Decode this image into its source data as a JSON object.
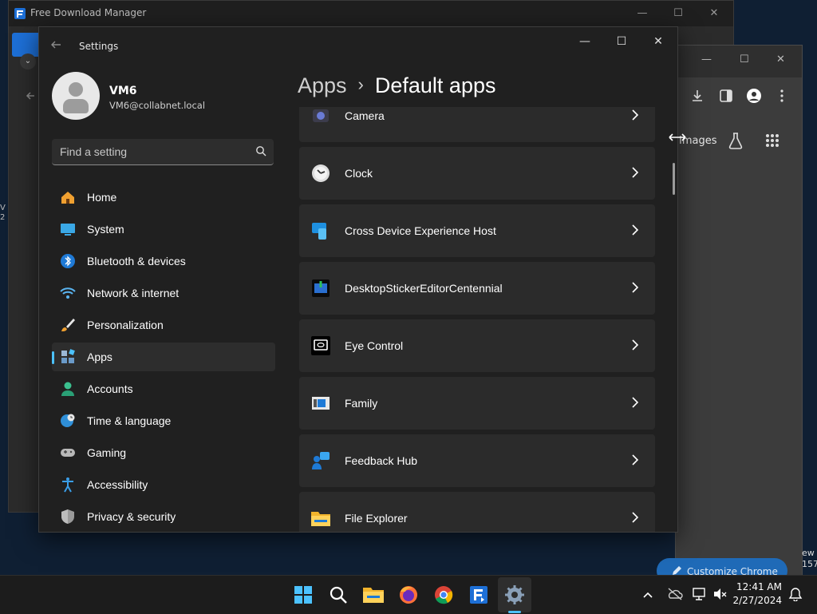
{
  "fdm": {
    "title": "Free Download Manager",
    "min": "—",
    "max": "☐",
    "close": "✕"
  },
  "chrome": {
    "images_label": "Images",
    "customize_label": "Customize Chrome",
    "partial_right_top": "ew",
    "partial_right_bottom": "157"
  },
  "desktop": {
    "left_edge_text": "V\n2"
  },
  "settings": {
    "title": "Settings",
    "user": {
      "name": "VM6",
      "email": "VM6@collabnet.local"
    },
    "search_placeholder": "Find a setting",
    "nav": [
      {
        "label": "Home",
        "icon": "home-icon"
      },
      {
        "label": "System",
        "icon": "system-icon"
      },
      {
        "label": "Bluetooth & devices",
        "icon": "bluetooth-icon"
      },
      {
        "label": "Network & internet",
        "icon": "wifi-icon"
      },
      {
        "label": "Personalization",
        "icon": "brush-icon"
      },
      {
        "label": "Apps",
        "icon": "apps-icon",
        "selected": true
      },
      {
        "label": "Accounts",
        "icon": "accounts-icon"
      },
      {
        "label": "Time & language",
        "icon": "globe-clock-icon"
      },
      {
        "label": "Gaming",
        "icon": "gamepad-icon"
      },
      {
        "label": "Accessibility",
        "icon": "accessibility-icon"
      },
      {
        "label": "Privacy & security",
        "icon": "shield-icon"
      }
    ],
    "breadcrumb": {
      "parent": "Apps",
      "separator": "›",
      "current": "Default apps"
    },
    "apps": [
      {
        "label": "Camera",
        "icon": "camera-icon"
      },
      {
        "label": "Clock",
        "icon": "clock-icon"
      },
      {
        "label": "Cross Device Experience Host",
        "icon": "cross-device-icon"
      },
      {
        "label": "DesktopStickerEditorCentennial",
        "icon": "sticker-editor-icon"
      },
      {
        "label": "Eye Control",
        "icon": "eye-control-icon"
      },
      {
        "label": "Family",
        "icon": "family-icon"
      },
      {
        "label": "Feedback Hub",
        "icon": "feedback-hub-icon"
      },
      {
        "label": "File Explorer",
        "icon": "folder-icon"
      }
    ]
  },
  "taskbar": {
    "items": [
      "windows-start-icon",
      "search-icon",
      "file-explorer-icon",
      "firefox-icon",
      "chrome-icon",
      "free-download-manager-icon",
      "settings-gear-icon"
    ],
    "time": "12:41 AM",
    "date": "2/27/2024"
  },
  "colors": {
    "accent": "#4cc2ff",
    "window_bg": "#202020",
    "card_bg": "#2b2b2b"
  }
}
